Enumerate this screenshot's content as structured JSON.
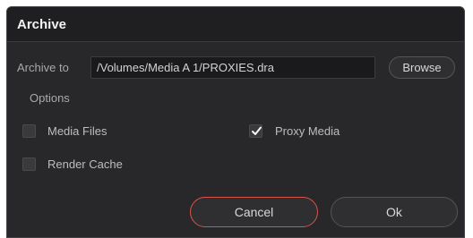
{
  "dialog": {
    "title": "Archive",
    "archive_to_label": "Archive to",
    "archive_path": "/Volumes/Media A 1/PROXIES.dra",
    "browse_label": "Browse",
    "options_label": "Options"
  },
  "options": {
    "media_files": {
      "label": "Media Files",
      "checked": false
    },
    "proxy_media": {
      "label": "Proxy Media",
      "checked": true
    },
    "render_cache": {
      "label": "Render Cache",
      "checked": false
    }
  },
  "buttons": {
    "cancel_label": "Cancel",
    "ok_label": "Ok"
  },
  "colors": {
    "background": "#28282a",
    "titlebar": "#1f1f21",
    "accent_focus": "#d9534a",
    "text": "#bdbdbf"
  }
}
